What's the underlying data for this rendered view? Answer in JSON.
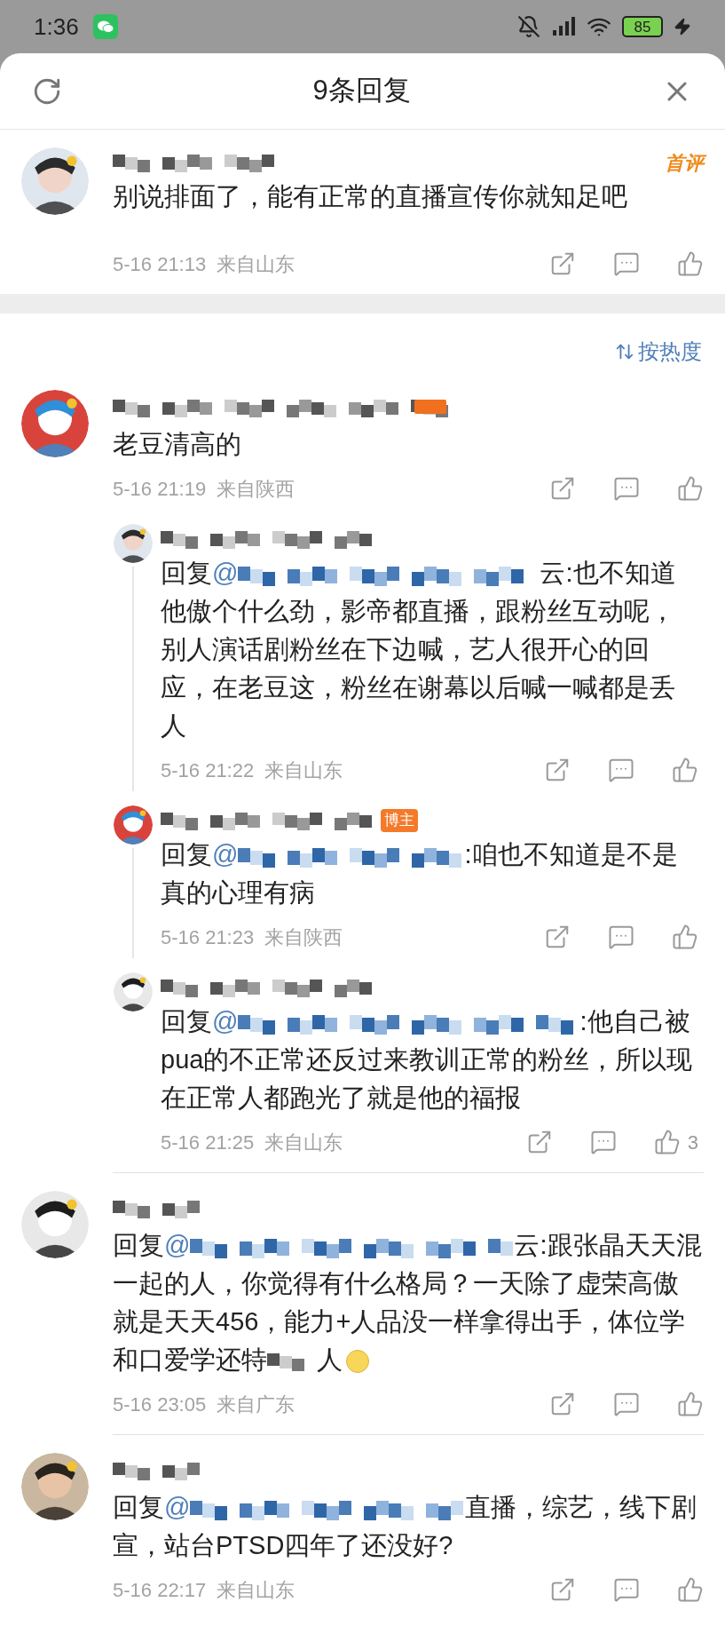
{
  "status_bar": {
    "time": "1:36",
    "battery": "85"
  },
  "header": {
    "title": "9条回复"
  },
  "first_comment": {
    "badge": "首评",
    "text": "别说排面了，能有正常的直播宣传你就知足吧",
    "time": "5-16 21:13",
    "location": "来自山东"
  },
  "sort": {
    "label": "按热度"
  },
  "comments": [
    {
      "text": "老豆清高的",
      "time": "5-16 21:19",
      "location": "来自陕西",
      "replies": [
        {
          "reply_label": "回复",
          "mention_prefix": "@",
          "text": "云:也不知道他傲个什么劲，影帝都直播，跟粉丝互动呢，别人演话剧粉丝在下边喊，艺人很开心的回应，在老豆这，粉丝在谢幕以后喊一喊都是丢人",
          "time": "5-16 21:22",
          "location": "来自山东"
        },
        {
          "badge": "博主",
          "reply_label": "回复",
          "mention_prefix": "@",
          "text": ":咱也不知道是不是真的心理有病",
          "time": "5-16 21:23",
          "location": "来自陕西"
        },
        {
          "reply_label": "回复",
          "mention_prefix": "@",
          "text": ":他自己被pua的不正常还反过来教训正常的粉丝，所以现在正常人都跑光了就是他的福报",
          "time": "5-16 21:25",
          "location": "来自山东",
          "likes": "3"
        }
      ]
    },
    {
      "reply_label": "回复",
      "mention_prefix": "@",
      "text": "云:跟张晶天天混一起的人，你觉得有什么格局？一天除了虚荣高傲就是天天456，能力+人品没一样拿得出手，体位学和口爱学还特",
      "text_after": "人",
      "time": "5-16 23:05",
      "location": "来自广东"
    },
    {
      "reply_label": "回复",
      "mention_prefix": "@",
      "text": "直播，综艺，线下剧宣，站台PTSD四年了还没好?",
      "time": "5-16 22:17",
      "location": "来自山东"
    }
  ]
}
